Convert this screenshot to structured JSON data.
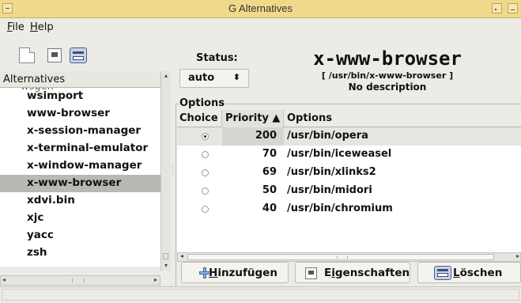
{
  "window": {
    "title": "G Alternatives"
  },
  "menubar": {
    "file": {
      "accel": "F",
      "rest": "ile"
    },
    "help": {
      "accel": "H",
      "rest": "elp"
    }
  },
  "toolbar": {
    "icons": [
      "new-document-icon",
      "properties-icon",
      "delete-icon"
    ]
  },
  "left": {
    "header": "Alternatives",
    "clipped_item": "wsgen",
    "items": [
      {
        "label": "wsimport"
      },
      {
        "label": "www-browser"
      },
      {
        "label": "x-session-manager"
      },
      {
        "label": "x-terminal-emulator"
      },
      {
        "label": "x-window-manager"
      },
      {
        "label": "x-www-browser"
      },
      {
        "label": "xdvi.bin"
      },
      {
        "label": "xjc"
      },
      {
        "label": "yacc"
      },
      {
        "label": "zsh"
      }
    ],
    "selected": "x-www-browser"
  },
  "status": {
    "label": "Status:",
    "value": "auto",
    "arrows": "⬍"
  },
  "alternative": {
    "name": "x-www-browser",
    "path": "[ /usr/bin/x-www-browser ]",
    "description": "No description"
  },
  "options": {
    "legend": "Options",
    "columns": {
      "choice": "Choice",
      "priority": "Priority ▲",
      "options": "Options"
    },
    "rows": [
      {
        "selected": true,
        "priority": "200",
        "path": "/usr/bin/opera"
      },
      {
        "selected": false,
        "priority": "70",
        "path": "/usr/bin/iceweasel"
      },
      {
        "selected": false,
        "priority": "69",
        "path": "/usr/bin/xlinks2"
      },
      {
        "selected": false,
        "priority": "50",
        "path": "/usr/bin/midori"
      },
      {
        "selected": false,
        "priority": "40",
        "path": "/usr/bin/chromium"
      }
    ]
  },
  "buttons": {
    "add": {
      "accel": "H",
      "rest": "inzufügen"
    },
    "properties": {
      "before": "E",
      "accel": "i",
      "rest": "genschaften"
    },
    "delete": {
      "accel": "L",
      "rest": "öschen"
    }
  },
  "scroll": {
    "left": "◂",
    "right": "▸",
    "up": "▴",
    "down": "▾"
  },
  "colors": {
    "titlebar": "#f0d98a",
    "selection": "#b9b8b4",
    "window_bg": "#ecebe6"
  }
}
